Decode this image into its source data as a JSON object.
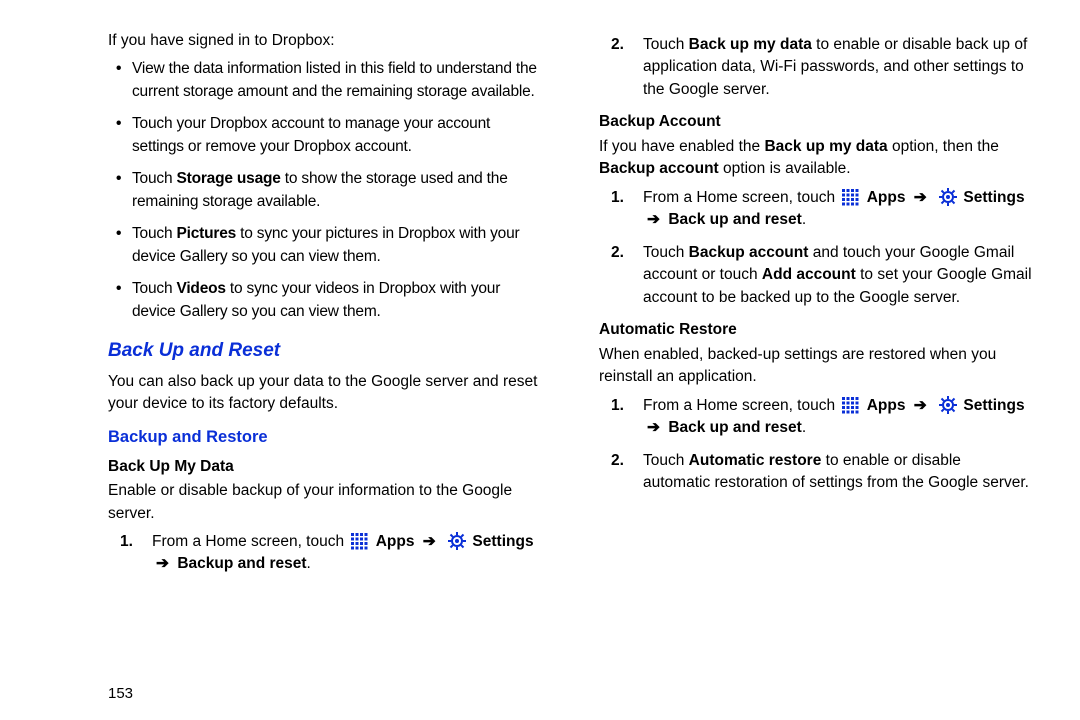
{
  "page_number": "153",
  "left": {
    "dropbox_intro": "If you have signed in to Dropbox:",
    "dropbox_bullets": [
      {
        "pre": "View the data information listed in this field to understand the current storage amount and the remaining storage available."
      },
      {
        "pre": "Touch your Dropbox account to manage your account settings or remove your Dropbox account."
      },
      {
        "pre": "Touch ",
        "bold": "Storage usage",
        "post": " to  show the storage used and the remaining storage available."
      },
      {
        "pre": "Touch ",
        "bold": "Pictures",
        "post": " to sync your pictures in Dropbox with your device Gallery so you can view them."
      },
      {
        "pre": "Touch ",
        "bold": "Videos",
        "post": " to sync your videos in Dropbox with your device Gallery so you can view them."
      }
    ],
    "h2_backup_reset": "Back Up and Reset",
    "backup_reset_intro": "You can also back up your data to the Google server and reset your device to its factory defaults.",
    "h3_backup_restore": "Backup and Restore",
    "h4_backup_my_data": "Back Up My Data",
    "backup_my_data_text": "Enable or disable backup of your information to the Google server.",
    "nav_from_home": "From a Home screen, touch",
    "apps_label": "Apps",
    "settings_label": "Settings",
    "backup_and_reset_label": "Back up and reset",
    "arrow": "➔",
    "backup_reset_path_end": "Backup and reset",
    "period": "."
  },
  "right": {
    "step2_touch_backup_pre": "Touch ",
    "step2_touch_backup_bold": "Back up my data",
    "step2_touch_backup_post": " to enable or disable back up of application data, Wi-Fi passwords, and other settings to the Google server.",
    "h4_backup_account": "Backup Account",
    "ba_text_pre": "If you have enabled the ",
    "ba_text_b1": "Back up my data",
    "ba_text_mid": " option, then the ",
    "ba_text_b2": "Backup account",
    "ba_text_post": " option is available.",
    "ba_step2_pre": "Touch ",
    "ba_step2_b1": "Backup account",
    "ba_step2_mid": " and touch your Google Gmail account or touch ",
    "ba_step2_b2": "Add account",
    "ba_step2_post": " to set your Google Gmail account to be backed up to the Google server.",
    "h4_auto_restore": "Automatic Restore",
    "ar_intro": "When enabled, backed-up settings are restored when you reinstall an application.",
    "ar_step2_pre": "Touch ",
    "ar_step2_b": "Automatic restore",
    "ar_step2_post": " to enable or disable automatic restoration of settings from the Google server."
  }
}
